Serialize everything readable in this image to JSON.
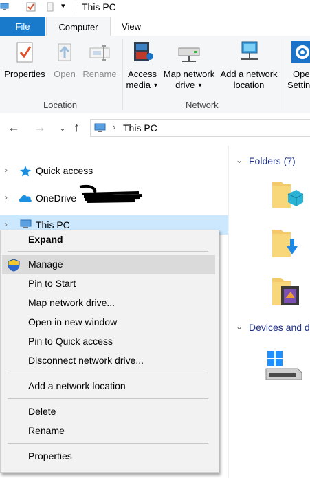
{
  "window": {
    "title": "This PC"
  },
  "ribbon": {
    "tabs": [
      {
        "label": "File"
      },
      {
        "label": "Computer"
      },
      {
        "label": "View"
      }
    ],
    "location_buttons": [
      {
        "label": "Properties"
      },
      {
        "label": "Open"
      },
      {
        "label": "Rename"
      }
    ],
    "location_group": "Location",
    "network_buttons": [
      {
        "line1": "Access",
        "line2": "media"
      },
      {
        "line1": "Map network",
        "line2": "drive"
      },
      {
        "line1": "Add a network",
        "line2": "location"
      },
      {
        "line1": "Ope",
        "line2": "Settin"
      }
    ],
    "network_group": "Network"
  },
  "address": {
    "path_item": "This PC",
    "chevron": "›"
  },
  "nav_pane": {
    "items": [
      {
        "label": "Quick access",
        "icon": "star-icon"
      },
      {
        "label": "OneDrive",
        "icon": "cloud-icon"
      },
      {
        "label": "This PC",
        "icon": "computer-icon"
      }
    ]
  },
  "content": {
    "folders_header": "Folders (7)",
    "devices_header": "Devices and d"
  },
  "context_menu": {
    "items": [
      {
        "label": "Expand"
      },
      {
        "label": "Manage"
      },
      {
        "label": "Pin to Start"
      },
      {
        "label": "Map network drive..."
      },
      {
        "label": "Open in new window"
      },
      {
        "label": "Pin to Quick access"
      },
      {
        "label": "Disconnect network drive..."
      },
      {
        "label": "Add a network location"
      },
      {
        "label": "Delete"
      },
      {
        "label": "Rename"
      },
      {
        "label": "Properties"
      }
    ]
  },
  "colors": {
    "file_tab": "#1979ca",
    "selection": "#cce8ff",
    "section_header": "#1e3287",
    "menu_background": "#f2f2f2",
    "menu_hover": "#dadada"
  }
}
